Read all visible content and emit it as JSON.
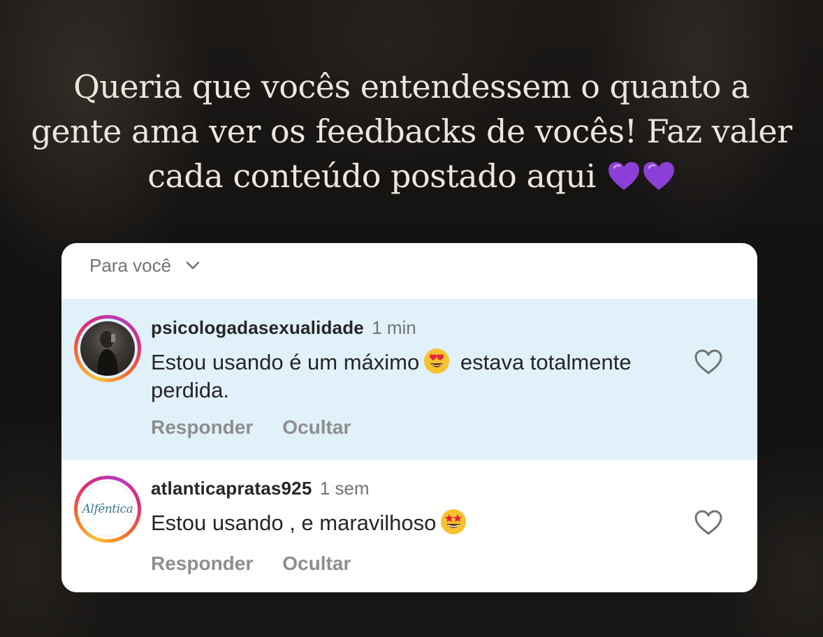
{
  "headline": {
    "text": "Queria que vocês entendessem o quanto a gente ama ver os feedbacks de vocês! Faz valer cada conteúdo postado aqui",
    "trailing_emoji": "💜💜"
  },
  "comments_panel": {
    "sort_label": "Para você",
    "comments": [
      {
        "username": "psicologadasexualidade",
        "time": "1 min",
        "text_before_emoji": "Estou usando é um máximo",
        "emoji": "😍",
        "text_after_emoji": "estava totalmente perdida.",
        "reply_label": "Responder",
        "hide_label": "Ocultar",
        "highlighted": true
      },
      {
        "username": "atlanticapratas925",
        "time": "1 sem",
        "avatar_logo_text": "Alfêntica",
        "text_before_emoji": "Estou usando , e maravilhoso",
        "emoji": "🤩",
        "text_after_emoji": "",
        "reply_label": "Responder",
        "hide_label": "Ocultar",
        "highlighted": false
      }
    ]
  },
  "colors": {
    "highlight_bg": "#e0f1fa",
    "heart_purple": "#8b3fd6",
    "text_primary": "#262626",
    "text_secondary": "#737373"
  },
  "icons": [
    "purple-heart-icon",
    "chevron-down-icon",
    "heart-outline-icon",
    "heart-eyes-emoji-icon",
    "star-struck-emoji-icon"
  ]
}
